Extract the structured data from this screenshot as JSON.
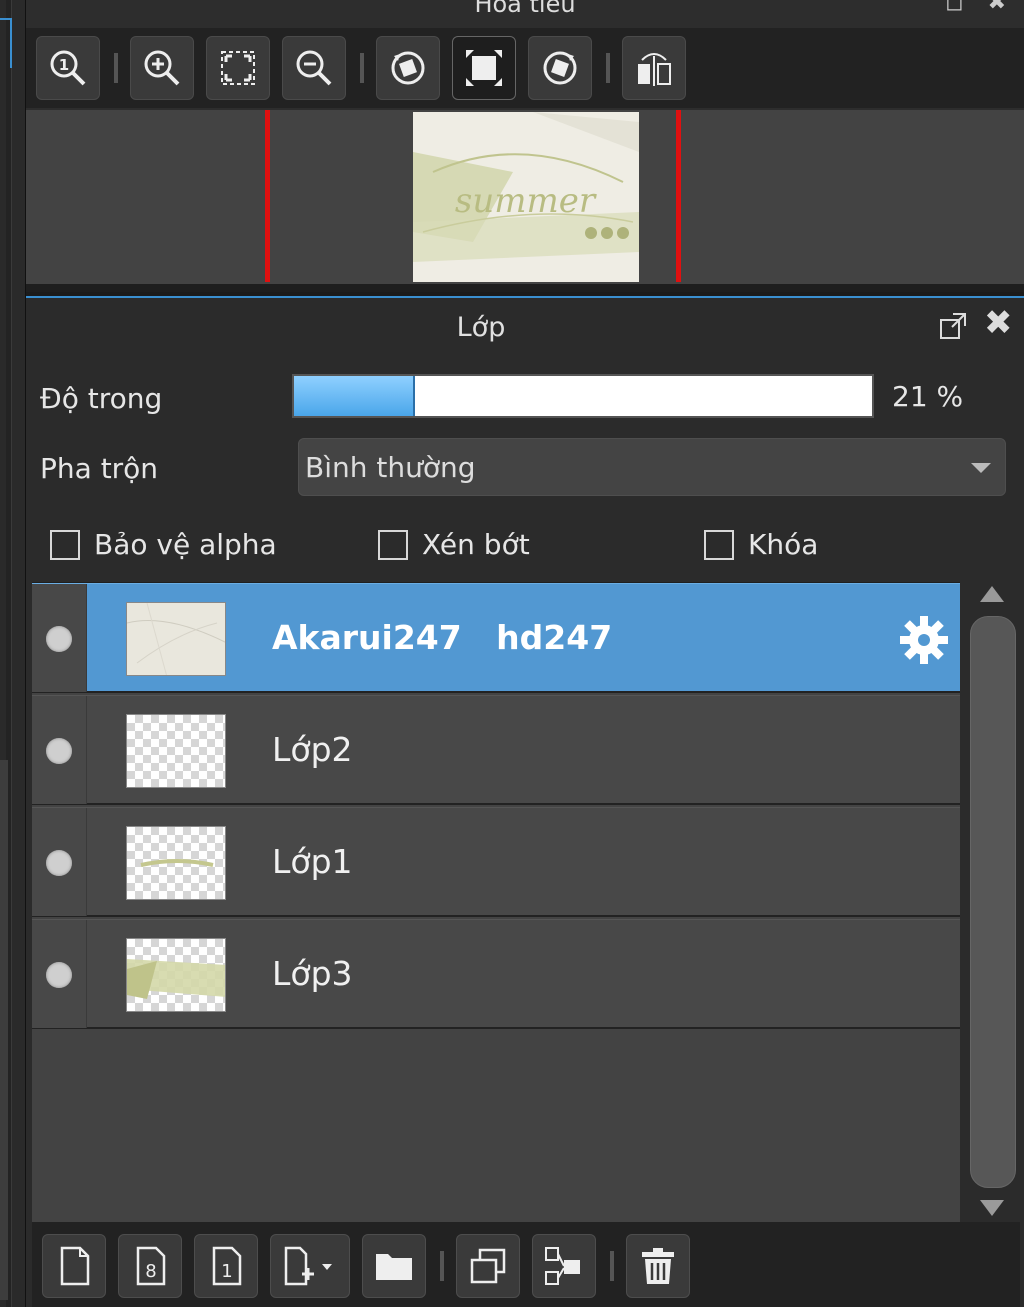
{
  "navigator": {
    "title": "Hoa tiêu",
    "toolbar": [
      {
        "icon": "zoom-actual-size-icon"
      },
      {
        "icon": "zoom-in-icon"
      },
      {
        "icon": "fit-to-window-icon"
      },
      {
        "icon": "zoom-out-icon"
      },
      {
        "icon": "rotate-left-icon"
      },
      {
        "icon": "reset-view-icon"
      },
      {
        "icon": "rotate-right-icon"
      },
      {
        "icon": "flip-horizontal-icon"
      }
    ],
    "preview_text": "summer"
  },
  "layer_panel": {
    "title": "Lớp",
    "opacity_label": "Độ trong",
    "opacity_percent": 21,
    "opacity_text": "21 %",
    "blend_label": "Pha trộn",
    "blend_value": "Bình thường",
    "checkboxes": {
      "protect_alpha": "Bảo vệ alpha",
      "clipping": "Xén bớt",
      "lock": "Khóa"
    },
    "layers": [
      {
        "name": "Akarui247   hd247",
        "selected": true
      },
      {
        "name": "Lớp2",
        "selected": false
      },
      {
        "name": "Lớp1",
        "selected": false
      },
      {
        "name": "Lớp3",
        "selected": false
      }
    ],
    "bottom_toolbar": [
      {
        "icon": "new-layer-icon"
      },
      {
        "icon": "new-8bit-layer-icon"
      },
      {
        "icon": "new-1bit-layer-icon"
      },
      {
        "icon": "add-layer-menu-icon"
      },
      {
        "icon": "new-folder-icon"
      },
      {
        "icon": "duplicate-layer-icon"
      },
      {
        "icon": "merge-down-icon"
      },
      {
        "icon": "delete-layer-icon"
      }
    ]
  },
  "colors": {
    "selection": "#5298d2",
    "accent": "#3a8fd0",
    "red_guide": "#e01010"
  }
}
